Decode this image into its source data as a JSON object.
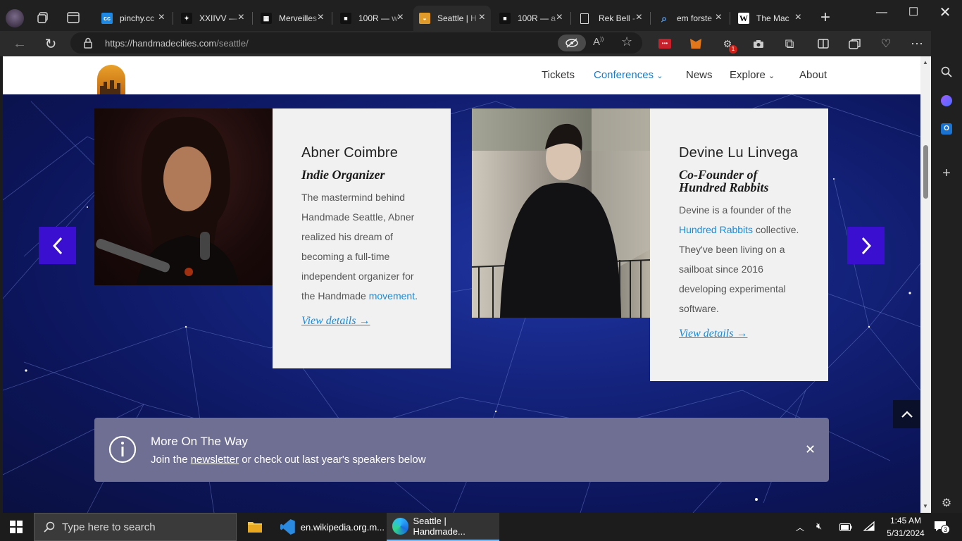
{
  "browser": {
    "tabs": [
      {
        "title": "pinchy.cc",
        "fav": "cc",
        "fav_color": "#1e88e5"
      },
      {
        "title": "XXIIVV — ",
        "fav": "✦",
        "fav_color": "#111111"
      },
      {
        "title": "Merveilles",
        "fav": "▦",
        "fav_color": "#111111"
      },
      {
        "title": "100R — w",
        "fav": "■",
        "fav_color": "#111111"
      },
      {
        "title": "Seattle | H",
        "fav": "◒",
        "fav_color": "#e09a2a"
      },
      {
        "title": "100R — a",
        "fav": "■",
        "fav_color": "#111111"
      },
      {
        "title": "Rek Bell -",
        "fav": "▯",
        "fav_color": "#2b2b2b"
      },
      {
        "title": "em forste",
        "fav": "⌕",
        "fav_color": "#2b2b2b"
      },
      {
        "title": "The Mac",
        "fav": "W",
        "fav_color": "#ffffff"
      }
    ],
    "url_base": "https://handmadecities.com",
    "url_path": "/seattle/",
    "badge_count": "1"
  },
  "site": {
    "nav": [
      "Tickets",
      "Conferences",
      "News",
      "Explore",
      "About"
    ],
    "speakers": [
      {
        "name": "Abner Coimbre",
        "role": "Indie Organizer",
        "bio_before": "The mastermind behind Handmade Seattle, Abner realized his dream of becoming a full-time independent organizer for the Handmade ",
        "bio_link": "movement",
        "bio_after": ".",
        "more": "View details →"
      },
      {
        "name": "Devine Lu Linvega",
        "role_line1": "Co-Founder of",
        "role_line2": "Hundred Rabbits",
        "bio_before": "Devine is a founder of the ",
        "bio_link": "Hundred Rabbits",
        "bio_after": " collective. They've been living on a sailboat since 2016 developing experimental software.",
        "more": "View details →"
      }
    ],
    "notice": {
      "title": "More On The Way",
      "text_before": "Join the ",
      "text_link": "newsletter",
      "text_after": " or check out last year's speakers below"
    }
  },
  "taskbar": {
    "search_placeholder": "Type here to search",
    "apps": [
      {
        "label": "en.wikipedia.org.m..."
      },
      {
        "label": "Seattle | Handmade..."
      }
    ],
    "time": "1:45 AM",
    "date": "5/31/2024",
    "notif_count": "3"
  },
  "colors": {
    "accent": "#1b8ad6",
    "arrow_button": "#3b0fd0",
    "notice_bg": "#6e6f92"
  }
}
